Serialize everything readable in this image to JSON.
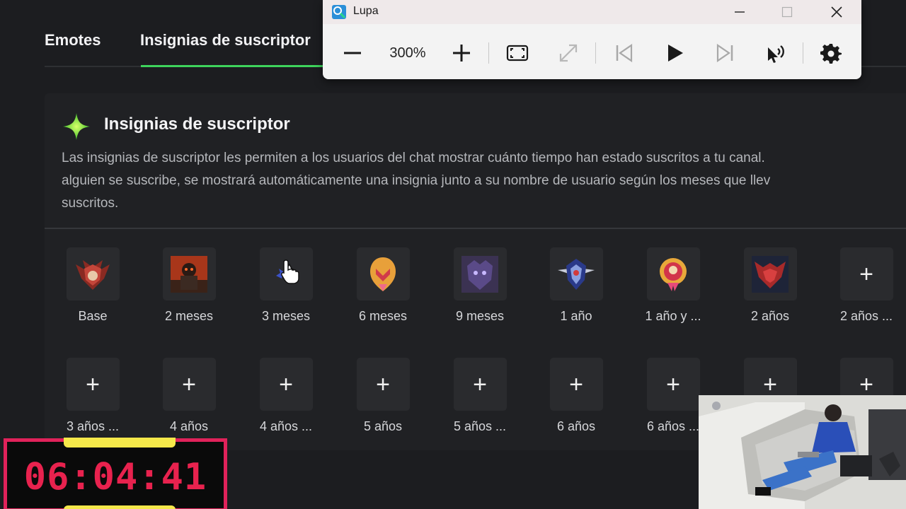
{
  "tabs": [
    {
      "label": "Emotes"
    },
    {
      "label": "Insignias de suscriptor"
    }
  ],
  "section": {
    "title": "Insignias de suscriptor",
    "description_lines": [
      "Las insignias de suscriptor les permiten a los usuarios del chat mostrar cuánto tiempo han estado suscritos a tu canal.",
      "alguien se suscribe, se mostrará automáticamente una insignia junto a su nombre de usuario según los meses que llev",
      "suscritos."
    ]
  },
  "badges_row1": [
    {
      "label": "Base",
      "icon": "red-shield-badge-icon"
    },
    {
      "label": "2 meses",
      "icon": "fire-warrior-badge-icon"
    },
    {
      "label": "3 meses",
      "icon": "blue-star-badge-icon"
    },
    {
      "label": "6 meses",
      "icon": "golden-helmet-badge-icon"
    },
    {
      "label": "9 meses",
      "icon": "purple-beast-badge-icon"
    },
    {
      "label": "1 año",
      "icon": "winged-blue-shield-badge-icon"
    },
    {
      "label": "1 año y ...",
      "icon": "gold-skull-medal-badge-icon"
    },
    {
      "label": "2 años",
      "icon": "red-demon-badge-icon"
    },
    {
      "label": "2 años ...",
      "icon": "plus-icon"
    }
  ],
  "badges_row2": [
    {
      "label": "3 años ...",
      "icon": "plus-icon"
    },
    {
      "label": "4 años",
      "icon": "plus-icon"
    },
    {
      "label": "4 años ...",
      "icon": "plus-icon"
    },
    {
      "label": "5 años",
      "icon": "plus-icon"
    },
    {
      "label": "5 años ...",
      "icon": "plus-icon"
    },
    {
      "label": "6 años",
      "icon": "plus-icon"
    },
    {
      "label": "6 años ...",
      "icon": "plus-icon"
    },
    {
      "label": "",
      "icon": "plus-icon"
    },
    {
      "label": "",
      "icon": "plus-icon"
    }
  ],
  "plus_glyph": "+",
  "magnifier": {
    "title": "Lupa",
    "zoom": "300%"
  },
  "timer": {
    "value": "06:04:41"
  },
  "colors": {
    "accent": "#3ed45c",
    "timer": "#e8224e",
    "timer_frame": "#e0225a",
    "timer_tabs": "#f5e84a"
  }
}
